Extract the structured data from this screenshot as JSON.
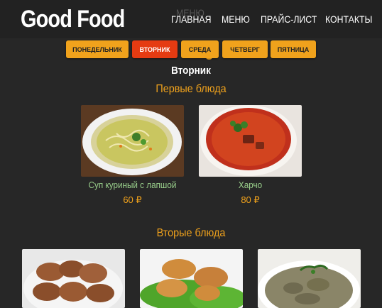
{
  "site": {
    "logo": "Good Food",
    "ghost_text": "МЕНЮ",
    "nav": [
      "ГЛАВНАЯ",
      "МЕНЮ",
      "ПРАЙС-ЛИСТ",
      "КОНТАКТЫ"
    ]
  },
  "days": [
    "ПОНЕДЕЛЬНИК",
    "ВТОРНИК",
    "СРЕДА",
    "ЧЕТВЕРГ",
    "ПЯТНИЦА"
  ],
  "active_day": "ВТОРНИК",
  "current_day_title": "Вторник",
  "sections": [
    {
      "title": "Первые блюда",
      "dishes": [
        {
          "name": "Суп куриный с лапшой",
          "price": "60 ₽",
          "image": "chicken-noodle-soup"
        },
        {
          "name": "Харчо",
          "price": "80 ₽",
          "image": "kharcho-soup"
        }
      ]
    },
    {
      "title": "Вторые блюда",
      "dishes": [
        {
          "image": "cutlets"
        },
        {
          "image": "cutlets-with-lettuce"
        },
        {
          "image": "meat-stew"
        }
      ]
    }
  ],
  "colors": {
    "background": "#272727",
    "accent": "#f0a21c",
    "active": "#e53b12",
    "dish_name": "#9ad08c"
  }
}
